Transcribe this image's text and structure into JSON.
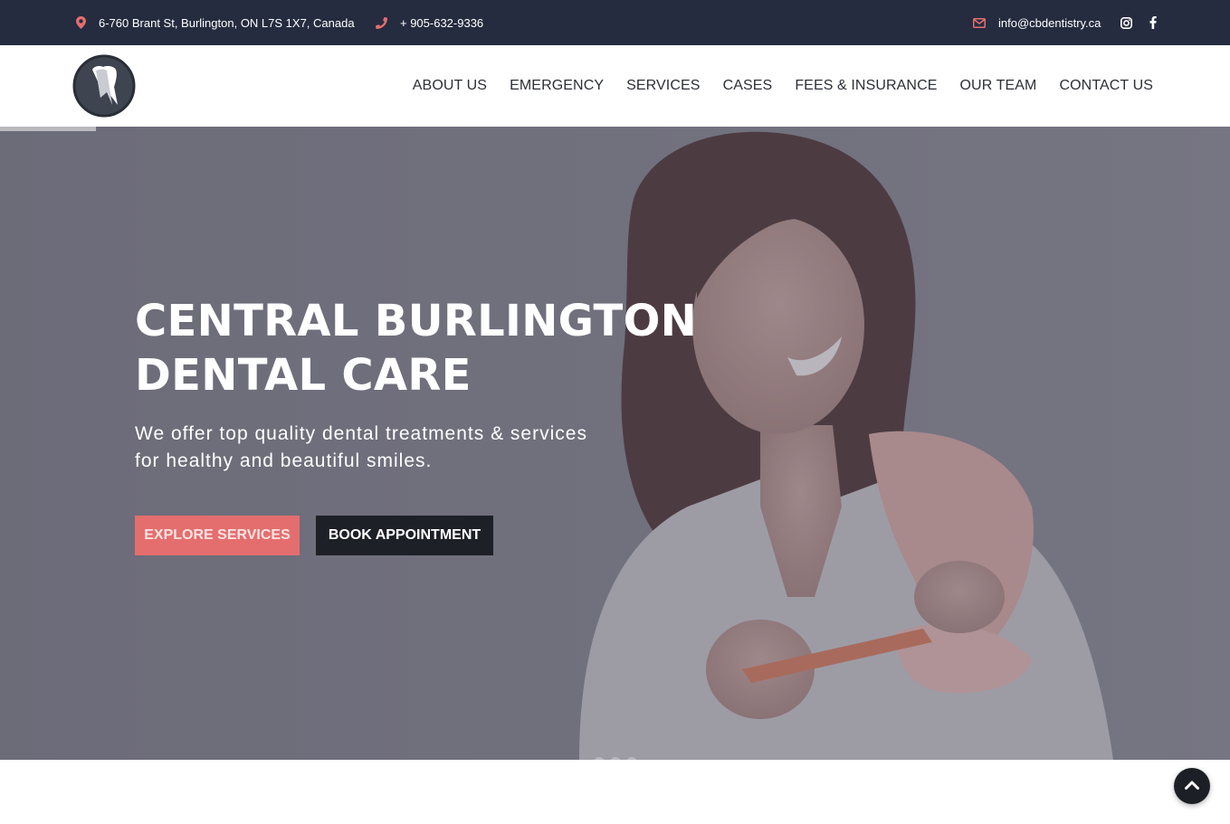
{
  "topbar": {
    "address": "6-760 Brant St, Burlington, ON L7S 1X7, Canada",
    "phone": "+ 905-632-9336",
    "email": "info@cbdentistry.ca",
    "address_icon": "map-marker-icon",
    "phone_icon": "phone-icon",
    "email_icon": "envelope-icon",
    "social": [
      "instagram-icon",
      "facebook-icon"
    ]
  },
  "nav": {
    "items": [
      {
        "label": "ABOUT US"
      },
      {
        "label": "EMERGENCY"
      },
      {
        "label": "SERVICES"
      },
      {
        "label": "CASES"
      },
      {
        "label": "FEES & INSURANCE"
      },
      {
        "label": "OUR TEAM"
      },
      {
        "label": "CONTACT US"
      }
    ]
  },
  "hero": {
    "title_line1": "CENTRAL BURLINGTON",
    "title_line2": "DENTAL CARE",
    "subtitle_line1": "We offer top quality dental treatments & services",
    "subtitle_line2": "for healthy and beautiful smiles.",
    "explore_label": "EXPLORE SERVICES",
    "book_label": "BOOK APPOINTMENT",
    "slide_count": 3
  },
  "colors": {
    "topbar_bg": "#252c3f",
    "accent": "#e46e6e",
    "dark_button": "#1e2027"
  }
}
